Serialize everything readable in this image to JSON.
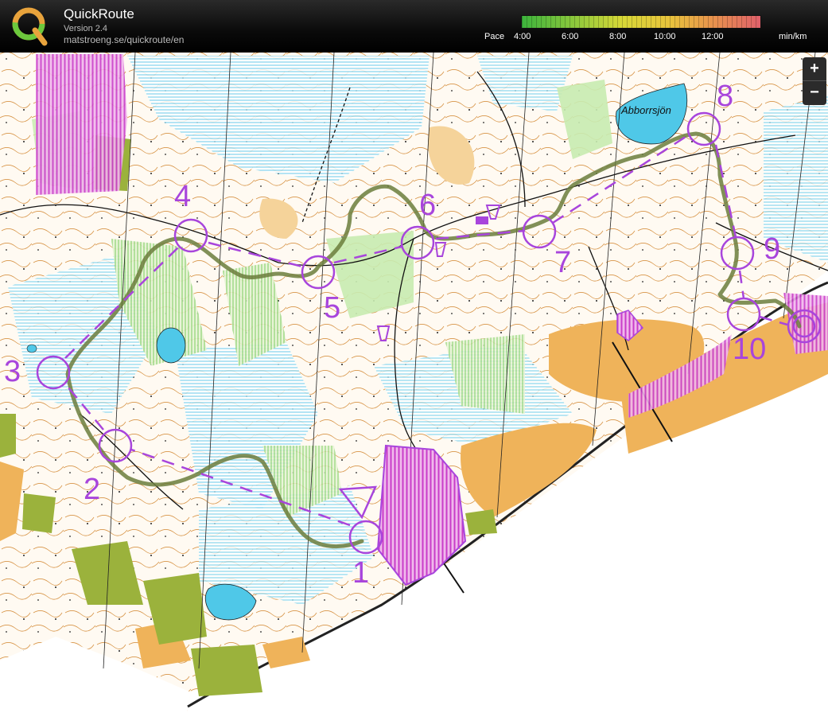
{
  "app": {
    "title": "QuickRoute",
    "version": "Version 2.4",
    "url": "matstroeng.se/quickroute/en"
  },
  "pace_legend": {
    "label": "Pace",
    "ticks": [
      "4:00",
      "6:00",
      "8:00",
      "10:00",
      "12:00"
    ],
    "unit": "min/km",
    "colors": [
      "#3cb43c",
      "#8cc83c",
      "#d7d837",
      "#e8c33c",
      "#e8934d",
      "#e0606a"
    ]
  },
  "zoom": {
    "in_label": "+",
    "out_label": "−"
  },
  "map": {
    "lake_name": "Abborrsjön",
    "course_color": "#a845dc",
    "route_color": "#7a8f45",
    "controls": [
      "1",
      "2",
      "3",
      "4",
      "5",
      "6",
      "7",
      "8",
      "9",
      "10"
    ]
  }
}
